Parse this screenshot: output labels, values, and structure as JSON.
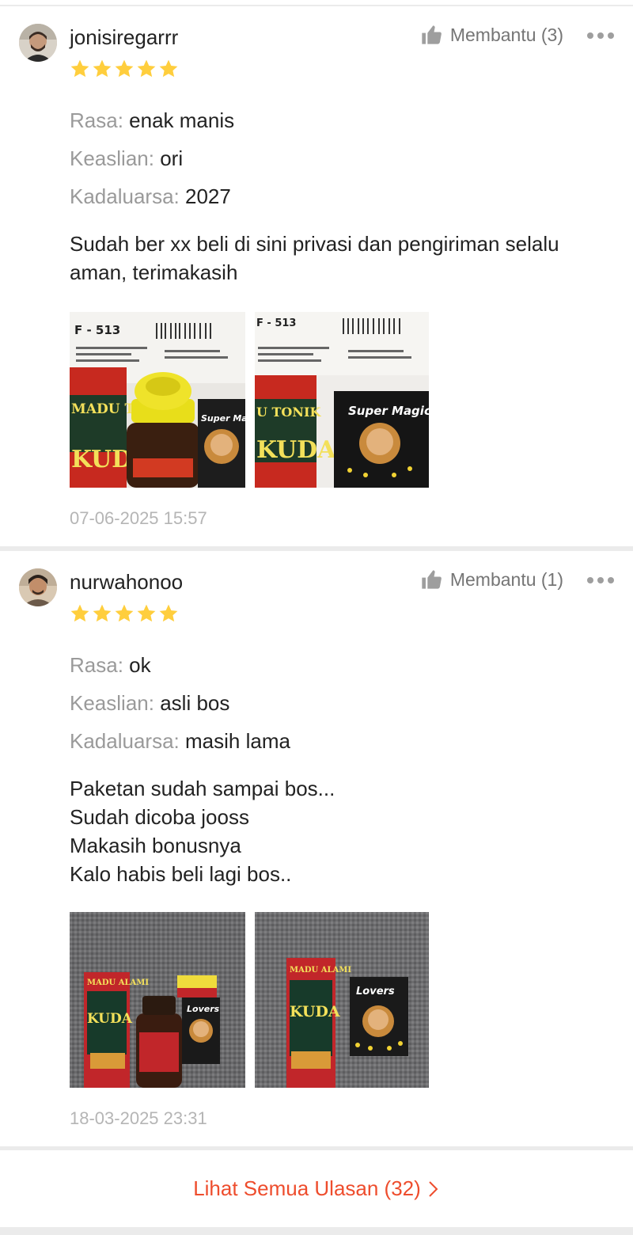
{
  "reviews": [
    {
      "username": "jonisiregarrr",
      "rating": 5,
      "helpful_label": "Membantu (3)",
      "attributes": [
        {
          "key": "Rasa:",
          "value": "enak manis"
        },
        {
          "key": "Keaslian:",
          "value": "ori"
        },
        {
          "key": "Kadaluarsa:",
          "value": "2027"
        }
      ],
      "comment": "Sudah ber xx beli di sini privasi dan pengiriman selalu aman, terimakasih",
      "timestamp": "07-06-2025 15:57",
      "photo_texts": [
        "F - 513",
        "MADU TONIK",
        "KUDA",
        "Super Magic"
      ]
    },
    {
      "username": "nurwahonoo",
      "rating": 5,
      "helpful_label": "Membantu (1)",
      "attributes": [
        {
          "key": "Rasa:",
          "value": "ok"
        },
        {
          "key": "Keaslian:",
          "value": "asli bos"
        },
        {
          "key": "Kadaluarsa:",
          "value": "masih lama"
        }
      ],
      "comment": "Paketan sudah sampai bos...\nSudah dicoba jooss\nMakasih bonusnya\nKalo habis beli lagi bos..",
      "timestamp": "18-03-2025 23:31",
      "photo_texts": [
        "MADU ALAMI",
        "KUDA",
        "Lovers"
      ]
    }
  ],
  "see_all_label": "Lihat Semua Ulasan (32)",
  "colors": {
    "star": "#ffce3d",
    "accent": "#ee4d2d",
    "muted": "#9a9a9a",
    "separator": "#ebebeb"
  },
  "icons": {
    "helpful": "thumbs-up-icon",
    "more": "more-options-icon",
    "see_all": "chevron-right-icon",
    "rating": "star-icon"
  }
}
